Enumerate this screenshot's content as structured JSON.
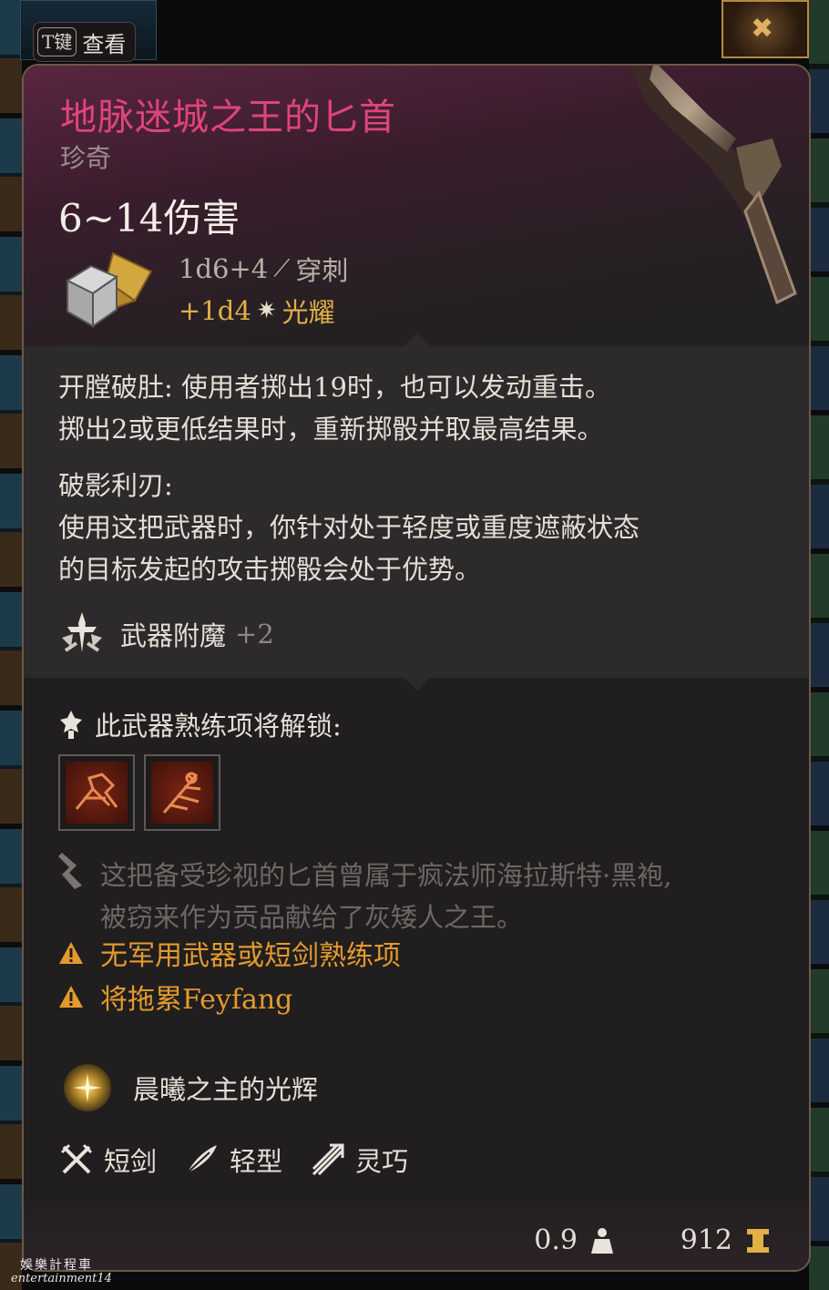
{
  "hint": {
    "key": "T键",
    "label": "查看"
  },
  "item": {
    "name": "地脉迷城之王的匕首",
    "rarity": "珍奇",
    "damage": "6~14伤害",
    "damage_rolls": [
      {
        "dice": "1d6+4",
        "type": "穿刺",
        "icon": "piercing-icon"
      },
      {
        "dice": "+1d4",
        "type": "光耀",
        "icon": "radiant-icon"
      }
    ]
  },
  "passives": {
    "p1_line1": "开膛破肚: 使用者掷出19时，也可以发动重击。",
    "p1_line2": "掷出2或更低结果时，重新掷骰并取最高结果。",
    "p2_title": "破影利刃:",
    "p2_line1": "使用这把武器时，你针对处于轻度或重度遮蔽状态",
    "p2_line2": "的目标发起的攻击掷骰会处于优势。",
    "enchant_label": "武器附魔",
    "enchant_value": "+2"
  },
  "proficiency": {
    "header": "此武器熟练项将解锁:"
  },
  "lore": {
    "line1": "这把备受珍视的匕首曾属于疯法师海拉斯特·黑袍,",
    "line2": "被窃来作为贡品献给了灰矮人之王。"
  },
  "warnings": [
    "无军用武器或短剑熟练项",
    "将拖累Feyfang"
  ],
  "special": "晨曦之主的光辉",
  "properties": [
    "短剑",
    "轻型",
    "灵巧"
  ],
  "footer": {
    "weight": "0.9",
    "price": "912"
  },
  "watermark": {
    "line1": "娛樂計程車",
    "line2": "entertainment14"
  },
  "colors": {
    "title": "#e0447c",
    "radiant": "#e1b046",
    "warning": "#e39a2c"
  }
}
